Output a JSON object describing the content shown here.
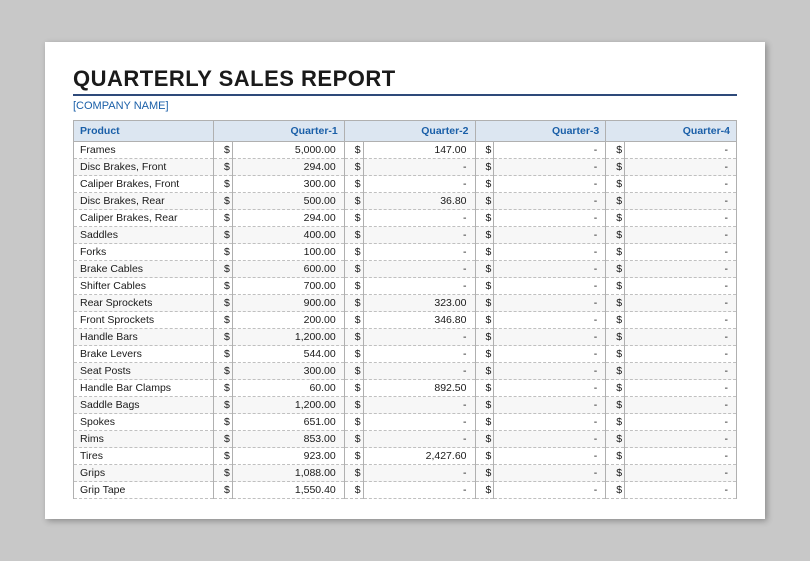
{
  "title": "QUARTERLY SALES REPORT",
  "company": "[COMPANY NAME]",
  "columns": {
    "product": "Product",
    "q1": "Quarter-1",
    "q2": "Quarter-2",
    "q3": "Quarter-3",
    "q4": "Quarter-4"
  },
  "rows": [
    {
      "product": "Frames",
      "q1": "5,000.00",
      "q2": "147.00",
      "q3": "-",
      "q4": "-"
    },
    {
      "product": "Disc Brakes, Front",
      "q1": "294.00",
      "q2": "-",
      "q3": "-",
      "q4": "-"
    },
    {
      "product": "Caliper Brakes, Front",
      "q1": "300.00",
      "q2": "-",
      "q3": "-",
      "q4": "-"
    },
    {
      "product": "Disc Brakes, Rear",
      "q1": "500.00",
      "q2": "36.80",
      "q3": "-",
      "q4": "-"
    },
    {
      "product": "Caliper Brakes, Rear",
      "q1": "294.00",
      "q2": "-",
      "q3": "-",
      "q4": "-"
    },
    {
      "product": "Saddles",
      "q1": "400.00",
      "q2": "-",
      "q3": "-",
      "q4": "-"
    },
    {
      "product": "Forks",
      "q1": "100.00",
      "q2": "-",
      "q3": "-",
      "q4": "-"
    },
    {
      "product": "Brake Cables",
      "q1": "600.00",
      "q2": "-",
      "q3": "-",
      "q4": "-"
    },
    {
      "product": "Shifter Cables",
      "q1": "700.00",
      "q2": "-",
      "q3": "-",
      "q4": "-"
    },
    {
      "product": "Rear Sprockets",
      "q1": "900.00",
      "q2": "323.00",
      "q3": "-",
      "q4": "-"
    },
    {
      "product": "Front Sprockets",
      "q1": "200.00",
      "q2": "346.80",
      "q3": "-",
      "q4": "-"
    },
    {
      "product": "Handle Bars",
      "q1": "1,200.00",
      "q2": "-",
      "q3": "-",
      "q4": "-"
    },
    {
      "product": "Brake Levers",
      "q1": "544.00",
      "q2": "-",
      "q3": "-",
      "q4": "-"
    },
    {
      "product": "Seat Posts",
      "q1": "300.00",
      "q2": "-",
      "q3": "-",
      "q4": "-"
    },
    {
      "product": "Handle Bar Clamps",
      "q1": "60.00",
      "q2": "892.50",
      "q3": "-",
      "q4": "-"
    },
    {
      "product": "Saddle Bags",
      "q1": "1,200.00",
      "q2": "-",
      "q3": "-",
      "q4": "-"
    },
    {
      "product": "Spokes",
      "q1": "651.00",
      "q2": "-",
      "q3": "-",
      "q4": "-"
    },
    {
      "product": "Rims",
      "q1": "853.00",
      "q2": "-",
      "q3": "-",
      "q4": "-"
    },
    {
      "product": "Tires",
      "q1": "923.00",
      "q2": "2,427.60",
      "q3": "-",
      "q4": "-"
    },
    {
      "product": "Grips",
      "q1": "1,088.00",
      "q2": "-",
      "q3": "-",
      "q4": "-"
    },
    {
      "product": "Grip Tape",
      "q1": "1,550.40",
      "q2": "-",
      "q3": "-",
      "q4": "-"
    }
  ]
}
